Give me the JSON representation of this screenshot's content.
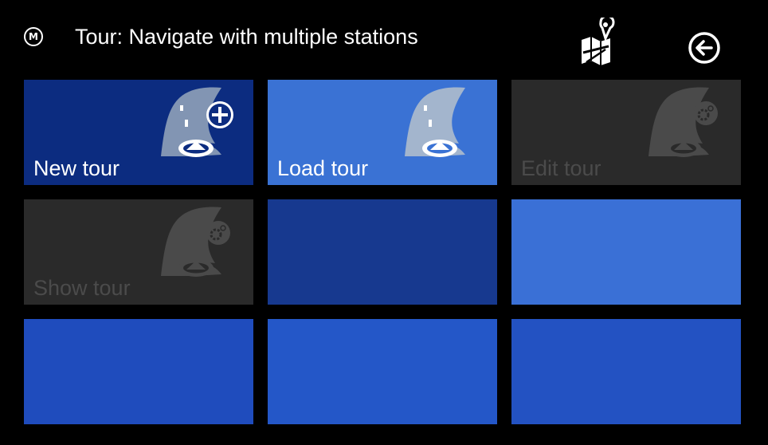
{
  "header": {
    "badge": "M",
    "title": "Tour: Navigate with multiple stations",
    "map_icon": "map-pin-edit-icon",
    "back_icon": "back-arrow-icon"
  },
  "tiles": [
    {
      "label": "New tour",
      "icon": "road-add-icon",
      "enabled": true,
      "color": "#0c2c80"
    },
    {
      "label": "Load tour",
      "icon": "road-icon",
      "enabled": true,
      "color": "#3a72d4"
    },
    {
      "label": "Edit tour",
      "icon": "road-settings-icon",
      "enabled": false,
      "color": "#2a2a2a"
    },
    {
      "label": "Show tour",
      "icon": "road-settings-icon",
      "enabled": false,
      "color": "#2a2a2a"
    },
    {
      "label": "",
      "icon": "",
      "enabled": true,
      "color": "#17398f"
    },
    {
      "label": "",
      "icon": "",
      "enabled": true,
      "color": "#3a70d6"
    },
    {
      "label": "",
      "icon": "",
      "enabled": true,
      "color": "#1f4cbd"
    },
    {
      "label": "",
      "icon": "",
      "enabled": true,
      "color": "#2457c8"
    },
    {
      "label": "",
      "icon": "",
      "enabled": true,
      "color": "#2352c2"
    }
  ]
}
